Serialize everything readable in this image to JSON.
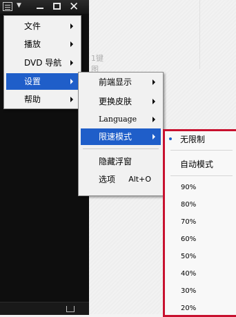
{
  "main_menu": {
    "items": [
      {
        "label": "文件"
      },
      {
        "label": "播放"
      },
      {
        "label": "DVD 导航"
      },
      {
        "label": "设置"
      },
      {
        "label": "帮助"
      }
    ]
  },
  "settings_menu": {
    "items": [
      {
        "label": "前端显示"
      },
      {
        "label": "更换皮肤"
      },
      {
        "label": "Language"
      },
      {
        "label": "限速模式"
      },
      {
        "label": "隐藏浮窗"
      },
      {
        "label": "选项",
        "shortcut": "Alt+O"
      }
    ]
  },
  "speed_menu": {
    "selected": "无限制",
    "auto": "自动模式",
    "levels": [
      "90%",
      "80%",
      "70%",
      "60%",
      "50%",
      "40%",
      "30%",
      "20%"
    ]
  },
  "colors": {
    "highlight": "#1f5ec9",
    "speed_menu_border": "#c8102e"
  }
}
